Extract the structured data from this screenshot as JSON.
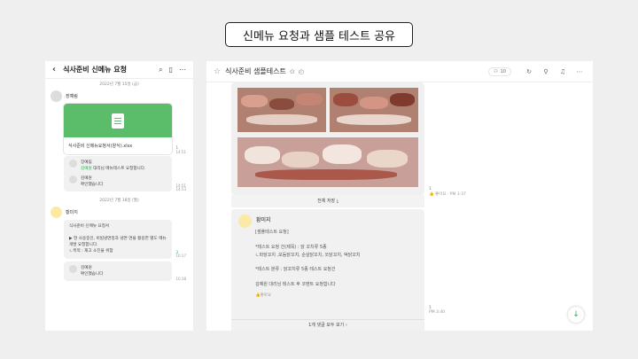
{
  "slide_title": "신메뉴 요청과 샘플 테스트 공유",
  "left_panel": {
    "title": "식사준비 신메뉴 요청",
    "date1": "2022년 7월 15일 (금)",
    "sender1": "장예림",
    "file_name": "식사준비 신메뉴요청서(양식).xlsx",
    "time1_count": "1",
    "time1": "14:51",
    "reply1_name": "장예림",
    "reply1_mention": "김예원",
    "reply1_text": " 대리님 메뉴테스트 요청합니다.",
    "time2": "14:51",
    "reply2_name": "김예원",
    "reply2_text": "확인했습니다",
    "time3": "14:53",
    "date2": "2022년 7월 18일 (월)",
    "sender2": "황미지",
    "bubble_lines": [
      "식사준비 신메뉴 요청서",
      "",
      "▶ 현 사용중인, 비빔냉면정과 냉면 면을 활용한 별도 메뉴 개발 요청합니다.",
      "ㄴ목적 : 재고 소진을 위함"
    ],
    "time4_count": "3",
    "time4": "10:17",
    "reply3_name": "김예원",
    "reply3_text": "확인했습니다",
    "time5": "10:18"
  },
  "right_panel": {
    "title": "식사준비 샘플테스트",
    "members": "10",
    "download_label": "전체 저장",
    "like1_count": "1",
    "like1_text": "좋아요 · PM 3:37",
    "msg_sender": "황미지",
    "msg_lines": [
      "[샘플테스트 요청]",
      "",
      "*테스트 요청 건(제목) : 닭 꼬치류 5종",
      "ㄴ파닭꼬치 ,모듬닭꼬치, 순살닭꼬치, 쏘닭꼬치, 떡닭꼬치",
      "",
      "*테스트 분류 : 닭꼬치류 5종 테스트 요청건",
      "",
      "김예원 대리님 테스트 후 코멘트 요청합니다"
    ],
    "msg_like": "좋아요",
    "like2_count": "1",
    "like2_text": "PM 3:40",
    "comments_label": "1개 댓글 모두 보기"
  }
}
